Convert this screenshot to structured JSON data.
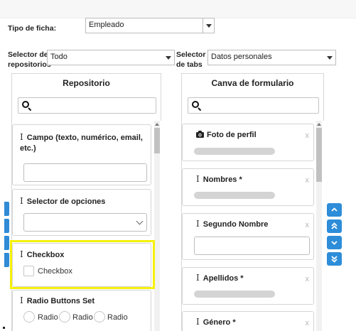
{
  "header": {
    "tipo_ficha_label": "Tipo de ficha:",
    "tipo_ficha_value": "Empleado",
    "selector_repos_label_line1": "Selector de",
    "selector_repos_label_line2": "repositorios",
    "selector_repos_value": "Todo",
    "selector_tabs_label_line1": "Selector",
    "selector_tabs_label_line2": "de tabs",
    "selector_tabs_value": "Datos personales"
  },
  "repositorio": {
    "title": "Repositorio",
    "search_value": "",
    "items": [
      {
        "title": "Campo (texto, numérico, email, etc.)"
      },
      {
        "title": "Selector de opciones"
      },
      {
        "title": "Checkbox",
        "option_label": "Checkbox"
      },
      {
        "title": "Radio Buttons Set",
        "radio_labels": [
          "Radio",
          "Radio",
          "Radio"
        ]
      }
    ]
  },
  "canva": {
    "title": "Canva de formulario",
    "search_value": "",
    "remove_label": "x",
    "items": [
      {
        "title": "Foto de perfil",
        "icon": "camera-icon"
      },
      {
        "title": "Nombres *",
        "icon": "text-cursor-icon"
      },
      {
        "title": "Segundo Nombre",
        "icon": "text-cursor-icon"
      },
      {
        "title": "Apellidos *",
        "icon": "text-cursor-icon"
      },
      {
        "title": "Género *",
        "icon": "text-cursor-icon"
      }
    ]
  },
  "colors": {
    "highlight": "#f5f10a",
    "accent_blue": "#2d8dd9"
  }
}
